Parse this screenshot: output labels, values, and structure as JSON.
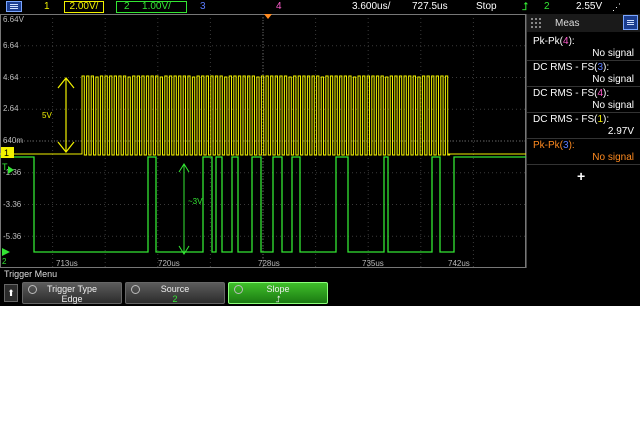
{
  "topbar": {
    "ch1_num": "1",
    "ch1_scale": "2.00V/",
    "ch2_num": "2",
    "ch2_scale": "1.00V/",
    "ch3_num": "3",
    "ch4_num": "4",
    "timebase": "3.600us/",
    "delay": "727.5us",
    "run_state": "Stop",
    "trig_source": "2",
    "trig_level": "2.55V"
  },
  "graticule": {
    "v_labels": [
      "6.64V",
      "6.64",
      "4.64",
      "2.64",
      "640m",
      "-1.36",
      "-3.36",
      "-5.36"
    ],
    "t_labels": [
      "713us",
      "720us",
      "728us",
      "735us",
      "742us"
    ],
    "annot_ch1": "5V",
    "annot_ch2": "~3V",
    "ch1_marker": "1",
    "trig_marker": "T",
    "ch2_marker": "2"
  },
  "meas": {
    "title": "Meas",
    "rows": [
      {
        "name_prefix": "Pk-Pk(",
        "ch": "4",
        "name_suffix": "):",
        "value": "No signal"
      },
      {
        "name_prefix": "DC RMS - FS(",
        "ch": "3",
        "name_suffix": "):",
        "value": "No signal"
      },
      {
        "name_prefix": "DC RMS - FS(",
        "ch": "4",
        "name_suffix": "):",
        "value": "No signal"
      },
      {
        "name_prefix": "DC RMS - FS(",
        "ch": "1",
        "name_suffix": "):",
        "value": "2.97V"
      },
      {
        "name_prefix": "Pk-Pk(",
        "ch": "3",
        "name_suffix": "):",
        "value": "No signal"
      }
    ],
    "add_label": "+"
  },
  "softkeys": {
    "menu_title": "Trigger Menu",
    "back_glyph": "⬆",
    "trigger_type_label": "Trigger Type",
    "trigger_type_value": "Edge",
    "source_label": "Source",
    "source_value": "2",
    "slope_label": "Slope",
    "slope_value": "⮥"
  },
  "colors": {
    "ch1": "#f2f200",
    "ch2": "#33e633",
    "ch3": "#5c7cff",
    "ch4": "#ff5ccd",
    "grid": "#3a3a3a",
    "accent": "#1b3d8f"
  }
}
